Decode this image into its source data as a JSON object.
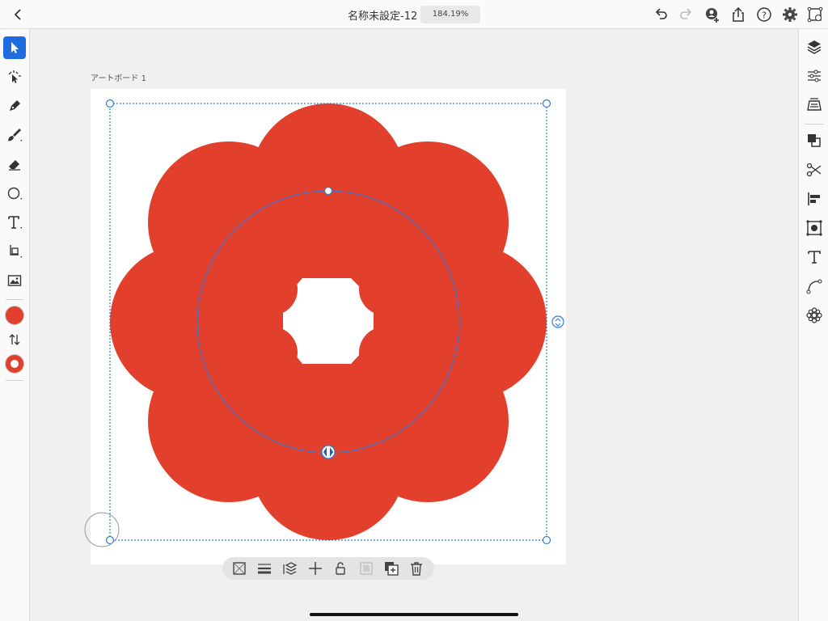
{
  "document": {
    "title": "名称未設定-12",
    "zoom": "184.19%"
  },
  "artboard": {
    "label": "アートボード 1"
  },
  "colors": {
    "accent": "#1f6ce0",
    "fill": "#e2402c",
    "selection": "#2d7dd6"
  },
  "toolbar_left": [
    "select-tool",
    "direct-select-tool",
    "pen-tool",
    "brush-tool",
    "eraser-tool",
    "ellipse-tool",
    "text-tool",
    "transform-tool",
    "image-tool",
    "fill-swatch",
    "swap-colors",
    "stroke-swatch"
  ],
  "toolbar_right": [
    "layers-icon",
    "properties-icon",
    "library-icon",
    "combine-icon",
    "scissors-icon",
    "align-icon",
    "symbols-icon",
    "text-settings-icon",
    "path-icon",
    "repeat-icon"
  ],
  "context_bar": [
    "transparency-icon",
    "stroke-weight-icon",
    "arrange-icon",
    "move-icon",
    "lock-icon",
    "group-icon",
    "duplicate-icon",
    "delete-icon"
  ]
}
